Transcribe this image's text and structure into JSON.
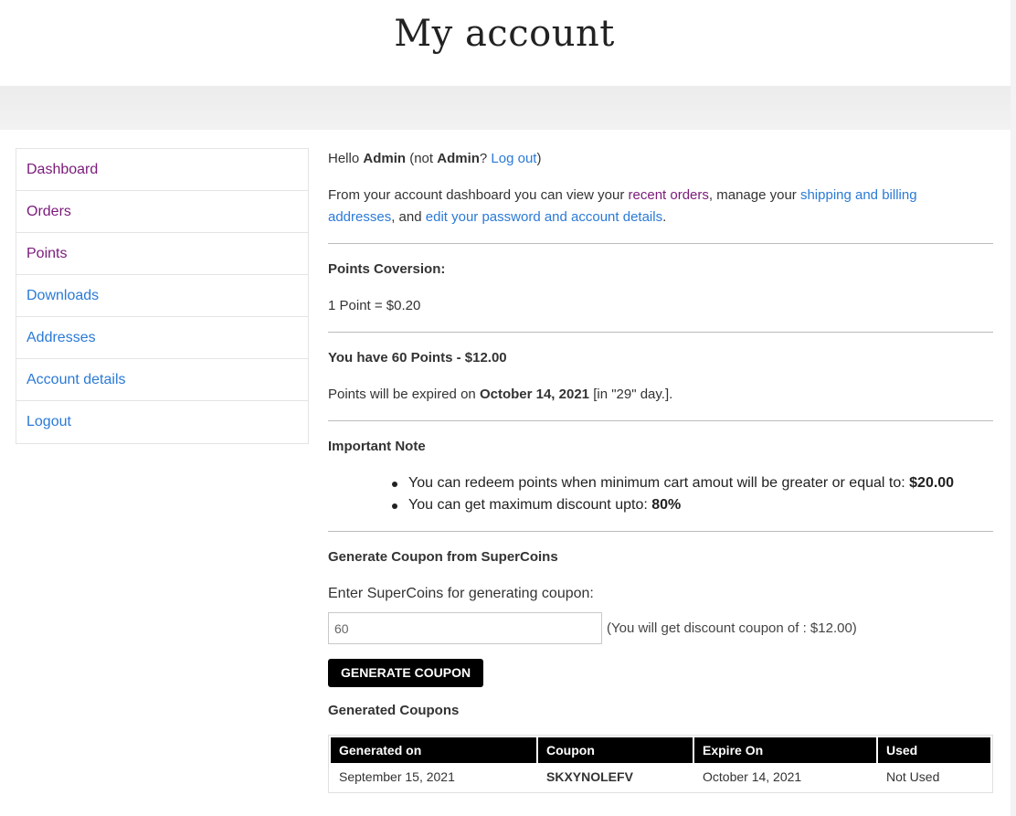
{
  "page": {
    "title": "My account"
  },
  "colors": {
    "visited_link": "#7a1a7a",
    "link": "#2a7ad6",
    "button_bg": "#000000"
  },
  "nav": {
    "items": [
      {
        "label": "Dashboard",
        "visited": true
      },
      {
        "label": "Orders",
        "visited": true
      },
      {
        "label": "Points",
        "visited": true
      },
      {
        "label": "Downloads",
        "visited": false
      },
      {
        "label": "Addresses",
        "visited": false
      },
      {
        "label": "Account details",
        "visited": false
      },
      {
        "label": "Logout",
        "visited": false
      }
    ]
  },
  "greeting": {
    "hello": "Hello",
    "user": "Admin",
    "not_prefix": "(not",
    "user2": "Admin",
    "question": "?",
    "logout_link": "Log out",
    "close": ")"
  },
  "dashboard_text": {
    "part1": "From your account dashboard you can view your",
    "recent_orders": "recent orders",
    "part2": ", manage your",
    "addresses_link_line1": "shipping and billing",
    "addresses_link_line2": "addresses",
    "part3": ", and",
    "account_link": "edit your password and account details",
    "part4": "."
  },
  "points_conversion": {
    "heading": "Points Coversion:",
    "rate": "1 Point = $0.20"
  },
  "balance": {
    "heading": "You have 60 Points - $12.00",
    "expiry_prefix": "Points will be expired on",
    "expiry_date": "October 14, 2021",
    "expiry_suffix": "[in \"29\" day.]."
  },
  "important_note": {
    "heading": "Important Note",
    "items": [
      {
        "text": "You can redeem points when minimum cart amout will be greater or equal to:",
        "value": "$20.00"
      },
      {
        "text": "You can get maximum discount upto:",
        "value": "80%"
      }
    ]
  },
  "generate": {
    "heading": "Generate Coupon from SuperCoins",
    "input_label": "Enter SuperCoins for generating coupon:",
    "input_value": "60",
    "hint": "(You will get discount coupon of : $12.00)",
    "button_label": "GENERATE COUPON"
  },
  "generated": {
    "heading": "Generated Coupons",
    "columns": [
      "Generated on",
      "Coupon",
      "Expire On",
      "Used"
    ],
    "rows": [
      {
        "generated_on": "September 15, 2021",
        "coupon": "SKXYNOLEFV",
        "expire_on": "October 14, 2021",
        "used": "Not Used"
      }
    ]
  }
}
